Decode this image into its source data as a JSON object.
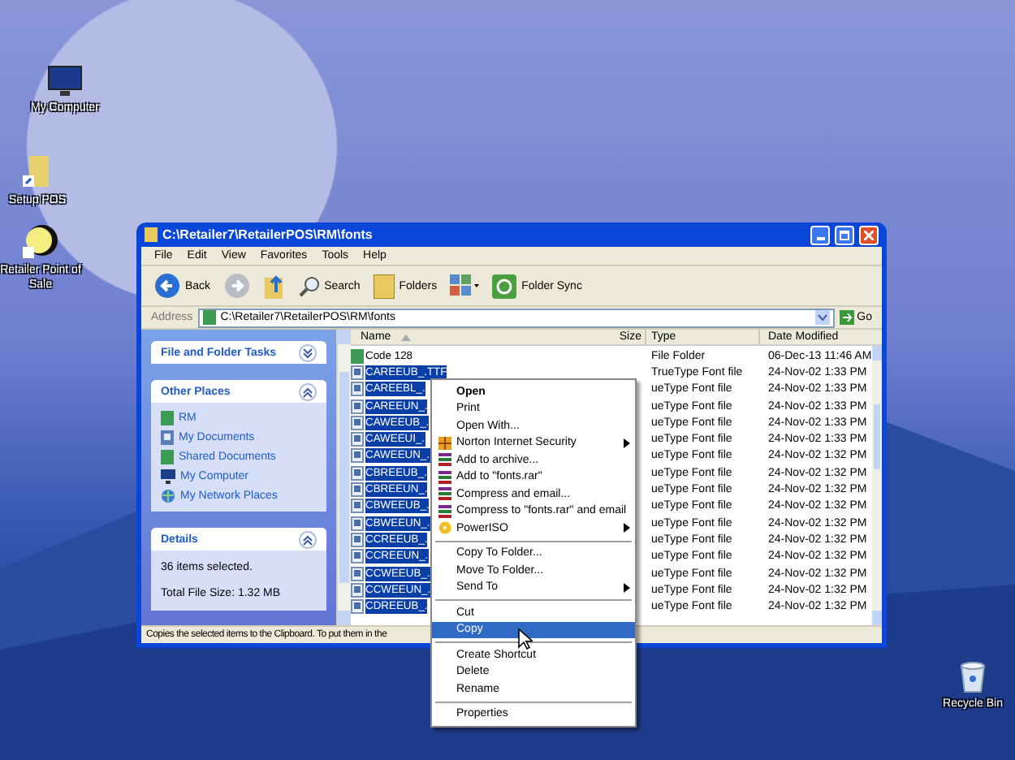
{
  "desktop_icons": [
    {
      "label": "My Computer",
      "kind": "computer"
    },
    {
      "label": "Setup POS",
      "kind": "folder"
    },
    {
      "label": "Retailer Point of Sale",
      "kind": "app"
    },
    {
      "label": "Recycle Bin",
      "kind": "bin"
    }
  ],
  "window": {
    "title": "C:\\Retailer7\\RetailerPOS\\RM\\fonts",
    "menu": [
      "File",
      "Edit",
      "View",
      "Favorites",
      "Tools",
      "Help"
    ],
    "toolbar": [
      {
        "kind": "back",
        "label": "Back"
      },
      {
        "kind": "forward"
      },
      {
        "kind": "up"
      },
      {
        "kind": "search",
        "label": "Search"
      },
      {
        "kind": "folders",
        "label": "Folders"
      },
      {
        "kind": "views"
      },
      {
        "kind": "sync",
        "label": "Folder Sync"
      }
    ],
    "address": {
      "label": "Address",
      "value": "C:\\Retailer7\\RetailerPOS\\RM\\fonts",
      "go": "Go"
    },
    "panels": [
      {
        "title": "File and Folder Tasks",
        "expanded": false
      },
      {
        "title": "Other Places",
        "expanded": true,
        "links": [
          {
            "label": "RM",
            "kind": "folder"
          },
          {
            "label": "My Documents",
            "kind": "docs"
          },
          {
            "label": "Shared Documents",
            "kind": "folder"
          },
          {
            "label": "My Computer",
            "kind": "computer"
          },
          {
            "label": "My Network Places",
            "kind": "network"
          }
        ]
      },
      {
        "title": "Details",
        "expanded": true,
        "lines": [
          "36 items selected.",
          "Total File Size: 1.32 MB"
        ]
      }
    ],
    "columns": [
      "Name",
      "Size",
      "Type",
      "Date Modified"
    ],
    "rows": [
      {
        "name": "Code 128",
        "kind": "folder",
        "type": "File Folder",
        "date": "06-Dec-13 11:46 AM",
        "selected": false
      },
      {
        "name": "CAREEUB_.TTF",
        "kind": "font",
        "type": "TrueType Font file",
        "date": "24-Nov-02 1:33 PM",
        "selected": true
      },
      {
        "name": "CAREEBL_.",
        "kind": "font",
        "type": "ueType Font file",
        "date": "24-Nov-02 1:33 PM",
        "selected": true
      },
      {
        "name": "CAREEUN_.",
        "kind": "font",
        "type": "ueType Font file",
        "date": "24-Nov-02 1:33 PM",
        "selected": true
      },
      {
        "name": "CAWEEUB_.",
        "kind": "font",
        "type": "ueType Font file",
        "date": "24-Nov-02 1:33 PM",
        "selected": true
      },
      {
        "name": "CAWEEUI_.",
        "kind": "font",
        "type": "ueType Font file",
        "date": "24-Nov-02 1:33 PM",
        "selected": true
      },
      {
        "name": "CAWEEUN_.",
        "kind": "font",
        "type": "ueType Font file",
        "date": "24-Nov-02 1:32 PM",
        "selected": true
      },
      {
        "name": "CBREEUB_.",
        "kind": "font",
        "type": "ueType Font file",
        "date": "24-Nov-02 1:32 PM",
        "selected": true
      },
      {
        "name": "CBREEUN_.",
        "kind": "font",
        "type": "ueType Font file",
        "date": "24-Nov-02 1:32 PM",
        "selected": true
      },
      {
        "name": "CBWEEUB_.",
        "kind": "font",
        "type": "ueType Font file",
        "date": "24-Nov-02 1:32 PM",
        "selected": true
      },
      {
        "name": "CBWEEUN_.",
        "kind": "font",
        "type": "ueType Font file",
        "date": "24-Nov-02 1:32 PM",
        "selected": true
      },
      {
        "name": "CCREEUB_.",
        "kind": "font",
        "type": "ueType Font file",
        "date": "24-Nov-02 1:32 PM",
        "selected": true
      },
      {
        "name": "CCREEUN_.",
        "kind": "font",
        "type": "ueType Font file",
        "date": "24-Nov-02 1:32 PM",
        "selected": true
      },
      {
        "name": "CCWEEUB_.",
        "kind": "font",
        "type": "ueType Font file",
        "date": "24-Nov-02 1:32 PM",
        "selected": true
      },
      {
        "name": "CCWEEUN_.",
        "kind": "font",
        "type": "ueType Font file",
        "date": "24-Nov-02 1:32 PM",
        "selected": true
      },
      {
        "name": "CDREEUB_.",
        "kind": "font",
        "type": "ueType Font file",
        "date": "24-Nov-02 1:32 PM",
        "selected": true
      }
    ],
    "status_bar": "Copies the selected items to the Clipboard. To put them in the"
  },
  "context_menu": [
    {
      "kind": "item",
      "label": "Open",
      "bold": true,
      "selected": false,
      "submenu": false
    },
    {
      "kind": "item",
      "label": "Print",
      "bold": false,
      "selected": false,
      "submenu": false
    },
    {
      "kind": "item",
      "label": "Open With...",
      "bold": false,
      "selected": false,
      "submenu": false
    },
    {
      "kind": "norton",
      "label": "Norton Internet Security",
      "bold": false,
      "selected": false,
      "submenu": true
    },
    {
      "kind": "archive",
      "label": "Add to archive...",
      "bold": false,
      "selected": false,
      "submenu": false
    },
    {
      "kind": "archive",
      "label": "Add to \"fonts.rar\"",
      "bold": false,
      "selected": false,
      "submenu": false
    },
    {
      "kind": "archive",
      "label": "Compress and email...",
      "bold": false,
      "selected": false,
      "submenu": false
    },
    {
      "kind": "archive",
      "label": "Compress to \"fonts.rar\" and email",
      "bold": false,
      "selected": false,
      "submenu": false
    },
    {
      "kind": "iso",
      "label": "PowerISO",
      "bold": false,
      "selected": false,
      "submenu": true
    },
    {
      "kind": "separator"
    },
    {
      "kind": "item",
      "label": "Copy To Folder...",
      "bold": false,
      "selected": false,
      "submenu": false
    },
    {
      "kind": "item",
      "label": "Move To Folder...",
      "bold": false,
      "selected": false,
      "submenu": false
    },
    {
      "kind": "item",
      "label": "Send To",
      "bold": false,
      "selected": false,
      "submenu": true
    },
    {
      "kind": "separator"
    },
    {
      "kind": "item",
      "label": "Cut",
      "bold": false,
      "selected": false,
      "submenu": false
    },
    {
      "kind": "item",
      "label": "Copy",
      "bold": false,
      "selected": true,
      "submenu": false
    },
    {
      "kind": "separator"
    },
    {
      "kind": "item",
      "label": "Create Shortcut",
      "bold": false,
      "selected": false,
      "submenu": false
    },
    {
      "kind": "item",
      "label": "Delete",
      "bold": false,
      "selected": false,
      "submenu": false
    },
    {
      "kind": "item",
      "label": "Rename",
      "bold": false,
      "selected": false,
      "submenu": false
    },
    {
      "kind": "separator"
    },
    {
      "kind": "item",
      "label": "Properties",
      "bold": false,
      "selected": false,
      "submenu": false
    }
  ]
}
